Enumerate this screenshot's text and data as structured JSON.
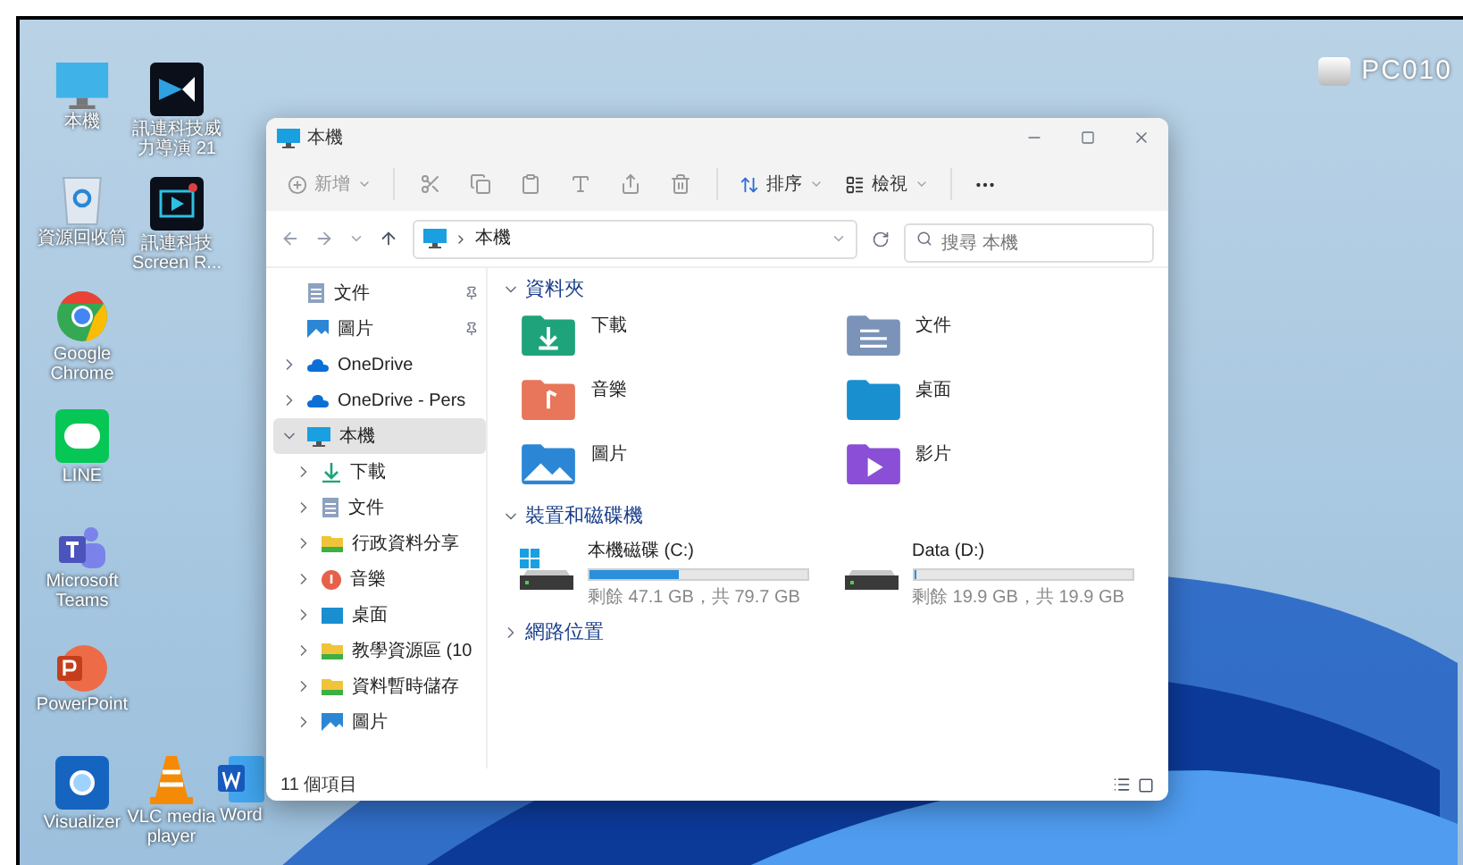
{
  "desktop_icons": [
    {
      "label": "本機",
      "kind": "computer"
    },
    {
      "label": "訊連科技威力導演 21",
      "kind": "director"
    },
    {
      "label": "資源回收筒",
      "kind": "recycle"
    },
    {
      "label": "訊連科技 Screen R...",
      "kind": "recorder"
    },
    {
      "label": "Google Chrome",
      "kind": "chrome"
    },
    {
      "label": "LINE",
      "kind": "line"
    },
    {
      "label": "Microsoft Teams",
      "kind": "teams"
    },
    {
      "label": "PowerPoint",
      "kind": "powerpoint"
    },
    {
      "label": "Visualizer",
      "kind": "visualizer"
    },
    {
      "label": "VLC media player",
      "kind": "vlc"
    },
    {
      "label": "Word",
      "kind": "word"
    }
  ],
  "logo": {
    "text": "PC010"
  },
  "window": {
    "title": "本機",
    "toolbar": {
      "new": "新增",
      "sort": "排序",
      "view": "檢視"
    },
    "address": {
      "path": "本機",
      "search_placeholder": "搜尋 本機"
    },
    "sidebar": [
      {
        "label": "文件",
        "kind": "docs",
        "pinned": true,
        "expanded": false,
        "selected": false
      },
      {
        "label": "圖片",
        "kind": "pictures",
        "pinned": true,
        "expanded": false,
        "selected": false
      },
      {
        "label": "OneDrive",
        "kind": "cloud",
        "pinned": false,
        "expanded": false,
        "selected": false
      },
      {
        "label": "OneDrive - Pers",
        "kind": "cloud",
        "pinned": false,
        "expanded": false,
        "selected": false
      },
      {
        "label": "本機",
        "kind": "computer",
        "pinned": false,
        "expanded": true,
        "selected": true,
        "children": [
          {
            "label": "下載",
            "kind": "download",
            "expanded": false,
            "selected": false
          },
          {
            "label": "文件",
            "kind": "docs",
            "expanded": false,
            "selected": false
          },
          {
            "label": "行政資料分享",
            "kind": "share",
            "expanded": false,
            "selected": false
          },
          {
            "label": "音樂",
            "kind": "music",
            "expanded": false,
            "selected": false
          },
          {
            "label": "桌面",
            "kind": "desktop",
            "expanded": false,
            "selected": false
          },
          {
            "label": "教學資源區 (10",
            "kind": "share",
            "expanded": false,
            "selected": false
          },
          {
            "label": "資料暫時儲存",
            "kind": "share",
            "expanded": false,
            "selected": false
          },
          {
            "label": "圖片",
            "kind": "pictures",
            "expanded": false,
            "selected": false
          }
        ]
      }
    ],
    "folders": {
      "heading": "資料夾",
      "expanded": true,
      "items": [
        {
          "label": "下載",
          "kind": "download"
        },
        {
          "label": "文件",
          "kind": "docs"
        },
        {
          "label": "音樂",
          "kind": "music"
        },
        {
          "label": "桌面",
          "kind": "desktop"
        },
        {
          "label": "圖片",
          "kind": "pictures"
        },
        {
          "label": "影片",
          "kind": "videos"
        }
      ]
    },
    "drives": {
      "heading": "裝置和磁碟機",
      "expanded": true,
      "items": [
        {
          "name": "本機磁碟 (C:)",
          "system": true,
          "level": 0.41,
          "free": "剩餘 47.1 GB，共 79.7 GB"
        },
        {
          "name": "Data (D:)",
          "system": false,
          "level": 0.01,
          "free": "剩餘 19.9 GB，共 19.9 GB"
        }
      ]
    },
    "network": {
      "heading": "網路位置",
      "expanded": false
    },
    "status": "11 個項目"
  }
}
